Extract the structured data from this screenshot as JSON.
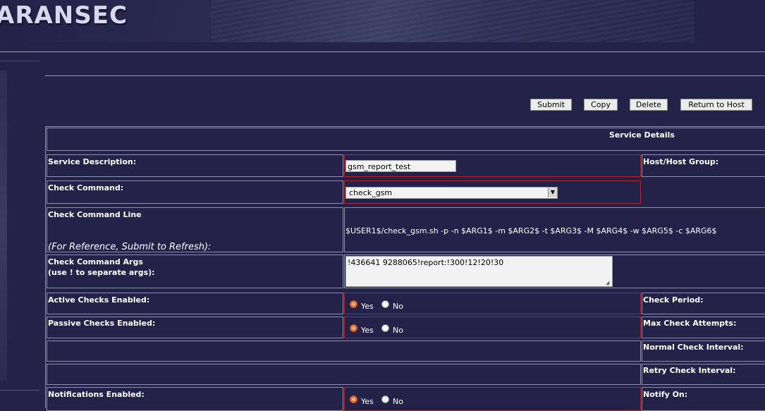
{
  "header": {
    "logo": "ARANSEC"
  },
  "toolbar": {
    "submit": "Submit",
    "copy": "Copy",
    "delete": "Delete",
    "return": "Return to Host"
  },
  "form": {
    "section_title": "Service Details",
    "service_description": {
      "label": "Service Description:",
      "value": "gsm_report_test"
    },
    "host_group": {
      "label": "Host/Host Group:"
    },
    "check_command": {
      "label": "Check Command:",
      "selected": "check_gsm"
    },
    "check_command_line": {
      "label": "Check Command Line",
      "note": "(For Reference, Submit to Refresh):",
      "value": "$USER1$/check_gsm.sh -p -n $ARG1$ -m $ARG2$ -t $ARG3$ -M $ARG4$ -w $ARG5$ -c $ARG6$"
    },
    "check_command_args": {
      "label_line1": "Check Command Args",
      "label_line2": "(use ! to separate args):",
      "value": "!436641 9288065!report:!300!12!20!30"
    },
    "active_checks": {
      "label": "Active Checks Enabled:",
      "yes": "Yes",
      "no": "No",
      "selected": "Yes"
    },
    "check_period": {
      "label": "Check Period:"
    },
    "passive_checks": {
      "label": "Passive Checks Enabled:",
      "yes": "Yes",
      "no": "No",
      "selected": "Yes"
    },
    "max_check_attempts": {
      "label": "Max Check Attempts:"
    },
    "normal_check_interval": {
      "label": "Normal Check Interval:"
    },
    "retry_check_interval": {
      "label": "Retry Check Interval:"
    },
    "notifications": {
      "label": "Notifications Enabled:",
      "yes": "Yes",
      "no": "No",
      "selected": "Yes"
    },
    "notify_on": {
      "label": "Notify On:"
    }
  },
  "colors": {
    "background": "#23234a",
    "error_border": "#b3262c",
    "radio_selected": "#f07a3a"
  }
}
